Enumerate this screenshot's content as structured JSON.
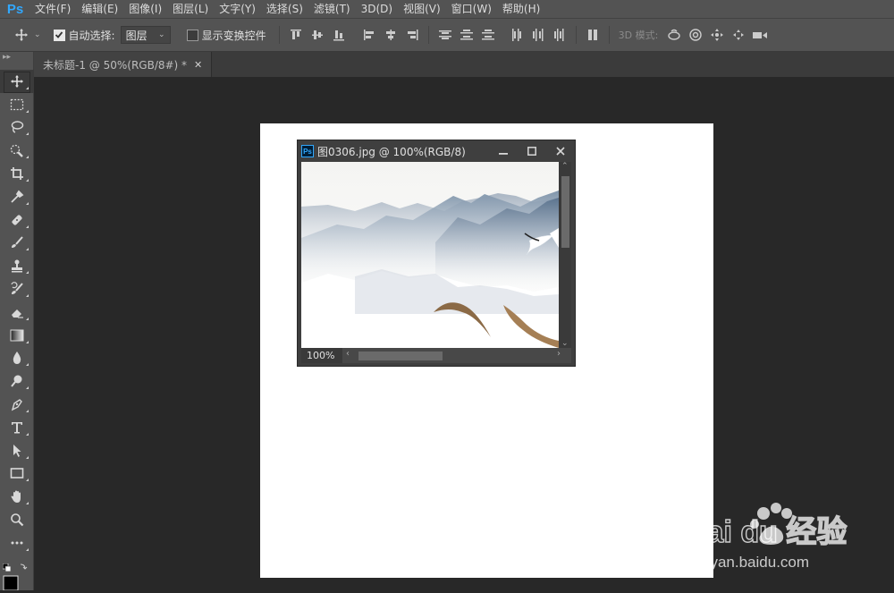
{
  "app": {
    "logo": "Ps"
  },
  "menu": [
    "文件(F)",
    "编辑(E)",
    "图像(I)",
    "图层(L)",
    "文字(Y)",
    "选择(S)",
    "滤镜(T)",
    "3D(D)",
    "视图(V)",
    "窗口(W)",
    "帮助(H)"
  ],
  "options": {
    "auto_select_label": "自动选择:",
    "auto_select_checked": true,
    "layer_select_value": "图层",
    "show_transform_label": "显示变换控件",
    "show_transform_checked": false,
    "mode_label": "3D 模式:"
  },
  "doc_tab": {
    "title": "未标题-1 @ 50%(RGB/8#) *"
  },
  "float_window": {
    "title": "图0306.jpg @ 100%(RGB/8)",
    "zoom": "100%"
  },
  "tools": [
    "move-tool",
    "marquee-tool",
    "lasso-tool",
    "quick-select-tool",
    "crop-tool",
    "eyedropper-tool",
    "healing-brush-tool",
    "brush-tool",
    "clone-stamp-tool",
    "history-brush-tool",
    "eraser-tool",
    "gradient-tool",
    "blur-tool",
    "dodge-tool",
    "pen-tool",
    "type-tool",
    "path-select-tool",
    "rectangle-tool",
    "hand-tool",
    "zoom-tool",
    "more-tools"
  ],
  "watermark": {
    "brand": "Bai du 经验",
    "url": "jingyan.baidu.com"
  },
  "colors": {
    "ps_blue": "#31a8ff",
    "chrome": "#535353",
    "canvas_bg": "#282828"
  }
}
